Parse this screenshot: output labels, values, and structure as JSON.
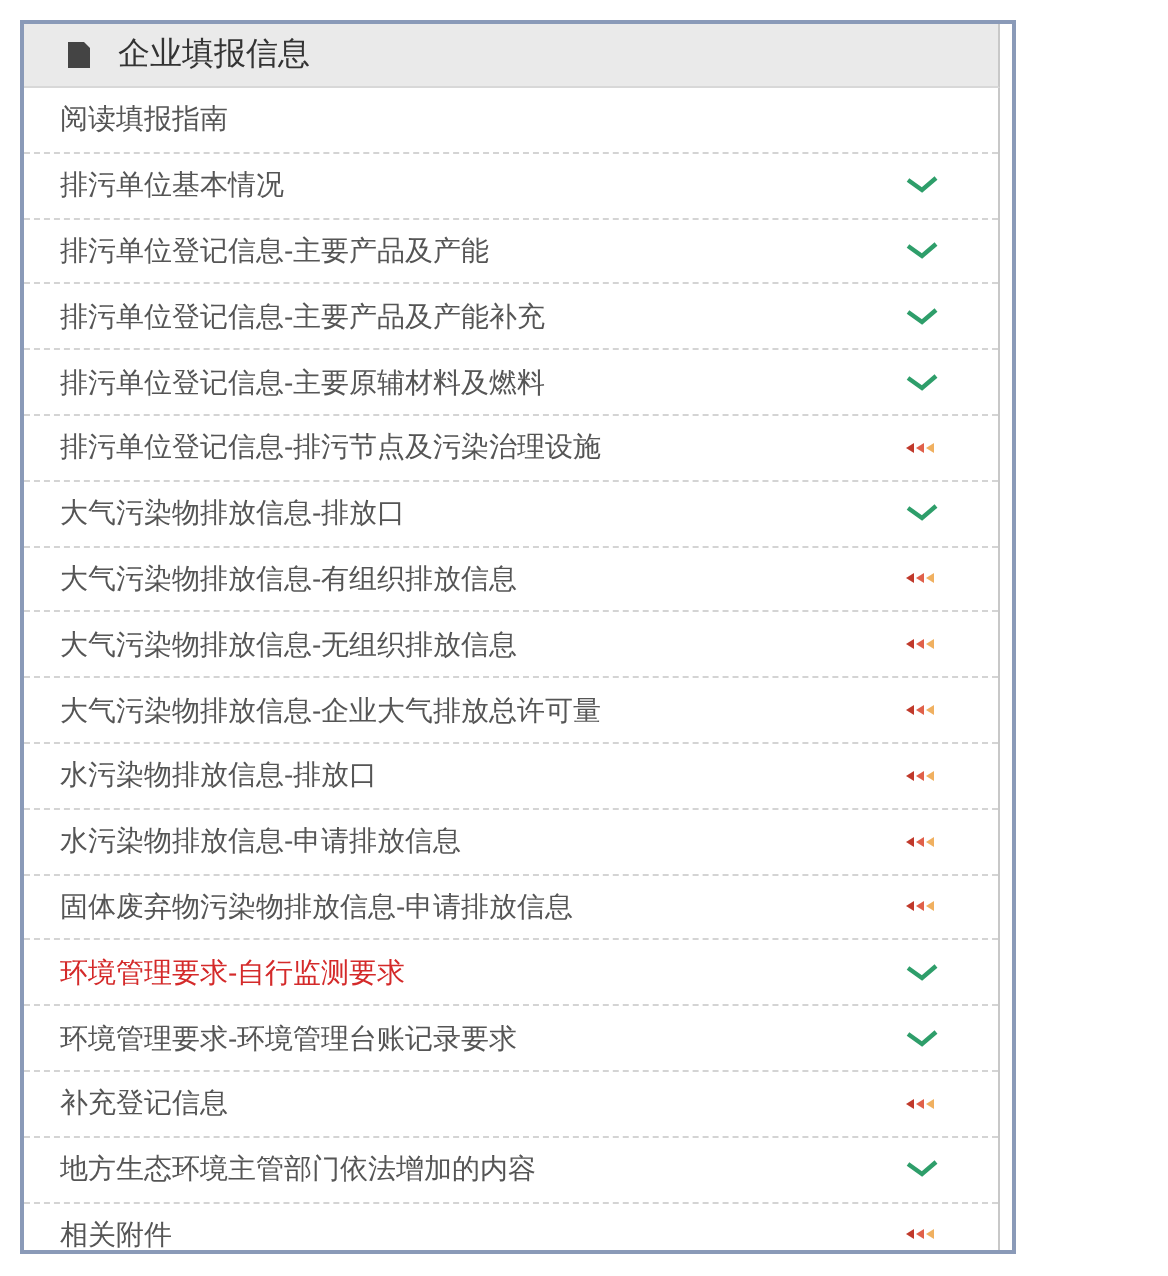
{
  "panel": {
    "title": "企业填报信息"
  },
  "items": [
    {
      "label": "阅读填报指南",
      "selected": false,
      "kind": "plain"
    },
    {
      "label": "排污单位基本情况",
      "selected": false,
      "kind": "done"
    },
    {
      "label": "排污单位登记信息-主要产品及产能",
      "selected": false,
      "kind": "done"
    },
    {
      "label": "排污单位登记信息-主要产品及产能补充",
      "selected": false,
      "kind": "done"
    },
    {
      "label": "排污单位登记信息-主要原辅材料及燃料",
      "selected": false,
      "kind": "done"
    },
    {
      "label": "排污单位登记信息-排污节点及污染治理设施",
      "selected": false,
      "kind": "pending"
    },
    {
      "label": "大气污染物排放信息-排放口",
      "selected": false,
      "kind": "done"
    },
    {
      "label": "大气污染物排放信息-有组织排放信息",
      "selected": false,
      "kind": "pending"
    },
    {
      "label": "大气污染物排放信息-无组织排放信息",
      "selected": false,
      "kind": "pending"
    },
    {
      "label": "大气污染物排放信息-企业大气排放总许可量",
      "selected": false,
      "kind": "pending"
    },
    {
      "label": "水污染物排放信息-排放口",
      "selected": false,
      "kind": "pending"
    },
    {
      "label": "水污染物排放信息-申请排放信息",
      "selected": false,
      "kind": "pending"
    },
    {
      "label": "固体废弃物污染物排放信息-申请排放信息",
      "selected": false,
      "kind": "pending"
    },
    {
      "label": "环境管理要求-自行监测要求",
      "selected": true,
      "kind": "done"
    },
    {
      "label": "环境管理要求-环境管理台账记录要求",
      "selected": false,
      "kind": "done"
    },
    {
      "label": "补充登记信息",
      "selected": false,
      "kind": "pending"
    },
    {
      "label": "地方生态环境主管部门依法增加的内容",
      "selected": false,
      "kind": "done"
    },
    {
      "label": "相关附件",
      "selected": false,
      "kind": "pending"
    }
  ]
}
